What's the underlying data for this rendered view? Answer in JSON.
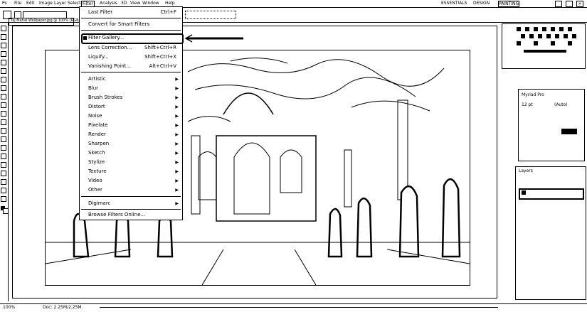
{
  "app": {
    "menubar": [
      "Ps",
      "File",
      "Edit",
      "Image",
      "Layer",
      "Select",
      "Filter",
      "Analysis",
      "3D",
      "View",
      "Window",
      "Help"
    ],
    "workspace": [
      "ESSENTIALS",
      "DESIGN",
      "PAINTING"
    ]
  },
  "document": {
    "tab_title": "Taj Mahal Wallpaper.jpg @ 100% (RGB/8)",
    "zoom": "100%",
    "doc_info": "Doc: 2.25M/2.25M"
  },
  "filter_menu": {
    "items": [
      {
        "label": "Last Filter",
        "shortcut": "Ctrl+F"
      },
      {
        "label": "Convert for Smart Filters",
        "shortcut": ""
      },
      {
        "label": "Filter Gallery...",
        "shortcut": "",
        "highlighted": true
      },
      {
        "label": "Lens Correction...",
        "shortcut": "Shift+Ctrl+R"
      },
      {
        "label": "Liquify...",
        "shortcut": "Shift+Ctrl+X"
      },
      {
        "label": "Vanishing Point...",
        "shortcut": "Alt+Ctrl+V"
      }
    ],
    "submenus": [
      "Artistic",
      "Blur",
      "Brush Strokes",
      "Distort",
      "Noise",
      "Pixelate",
      "Render",
      "Sharpen",
      "Sketch",
      "Stylize",
      "Texture",
      "Video",
      "Other"
    ],
    "plugins": [
      "Digimarc"
    ],
    "footer": "Browse Filters Online..."
  },
  "panels": {
    "character": {
      "font": "Myriad Pro",
      "size": "12 pt",
      "leading": "(Auto)"
    },
    "layers_label": "Layers"
  },
  "colors": {
    "ink": "#000000",
    "bg": "#ffffff"
  }
}
